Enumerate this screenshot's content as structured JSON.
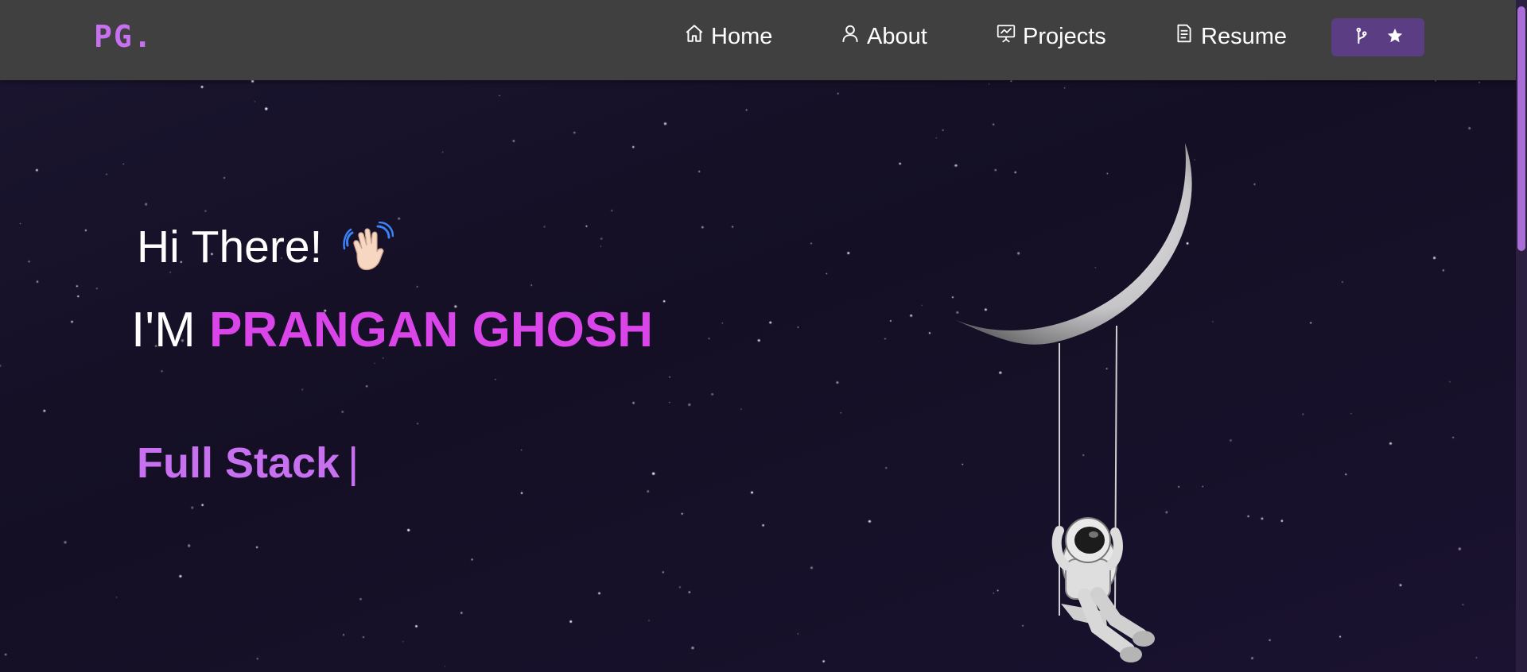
{
  "brand": {
    "logo": "PG."
  },
  "nav": {
    "items": [
      {
        "label": "Home",
        "icon": "home-icon"
      },
      {
        "label": "About",
        "icon": "user-icon"
      },
      {
        "label": "Projects",
        "icon": "presentation-chart-icon"
      },
      {
        "label": "Resume",
        "icon": "document-icon"
      }
    ],
    "github_button": {
      "icons": [
        "git-fork-icon",
        "star-icon"
      ]
    }
  },
  "hero": {
    "greeting": "Hi There!",
    "name_prefix": "I'M",
    "name": "PRANGAN GHOSH",
    "typed_text": "Full Stack",
    "cursor": "|"
  },
  "colors": {
    "accent": "#c770f0",
    "name": "#d945e8",
    "navbar": "#404040",
    "background": "#140f24",
    "button": "#5b3d83"
  }
}
